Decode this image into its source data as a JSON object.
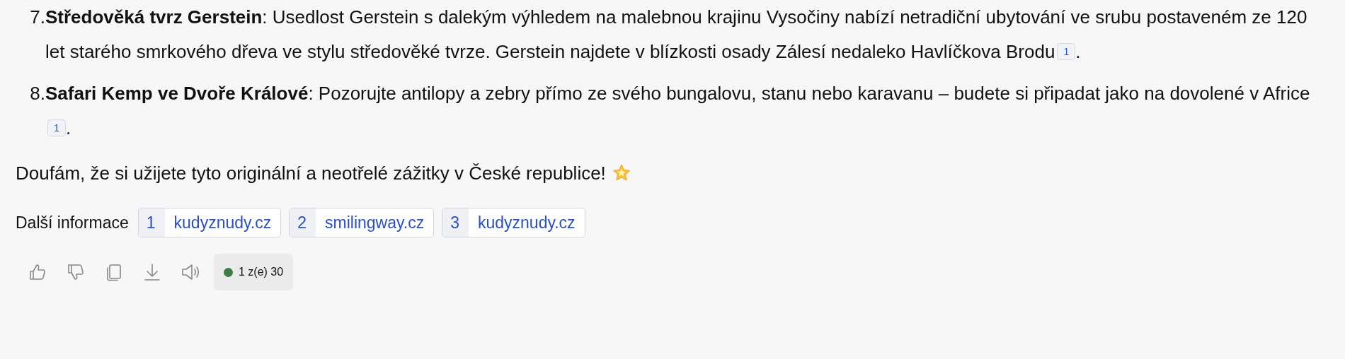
{
  "list": {
    "items": [
      {
        "number": "7.",
        "text": "**Středověká tvrz Gerstein**: Usedlost Gerstein s dalekým výhledem na malebnou krajinu Vysočiny nabízí netradiční ubytování ve srubu postaveném ze 120 let starého smrkového dřeva ve stylu středověké tvrze. Gerstein najdete v blízkosti osady Zálesí nedaleko Havlíčkova Brodu",
        "citation": "1",
        "end": "."
      },
      {
        "number": "8.",
        "text": "**Safari Kemp ve Dvoře Králové**: Pozorujte antilopy a zebry přímo ze svého bungalovu, stanu nebo karavanu – budete si připadat jako na dovolené v Africe",
        "citation": "1",
        "end": "."
      }
    ]
  },
  "closing": "Doufám, že si užijete tyto originální a neotřelé zážitky v České republice!",
  "sources": {
    "label": "Další informace",
    "links": [
      {
        "number": "1",
        "site": "kudyznudy.cz"
      },
      {
        "number": "2",
        "site": "smilingway.cz"
      },
      {
        "number": "3",
        "site": "kudyznudy.cz"
      }
    ]
  },
  "actions": [
    {
      "kind": "like"
    },
    {
      "kind": "dislike"
    },
    {
      "kind": "copy"
    },
    {
      "kind": "download"
    },
    {
      "kind": "speak"
    }
  ],
  "counter": "1 z(e) 30"
}
